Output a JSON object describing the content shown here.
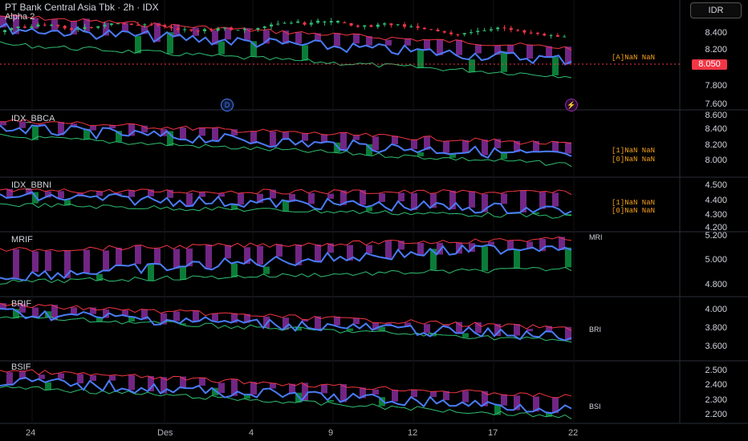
{
  "header": {
    "title": "PT Bank Central Asia Tbk · 2h · IDX",
    "indicator": "Alpha 2"
  },
  "currency_button": "IDR",
  "price_badge": "8.050",
  "main_legend": "[A]NaN NaN",
  "markers": {
    "dividend": "D",
    "split": "⚡"
  },
  "panes": [
    {
      "label": "",
      "ticks": [
        "8.400",
        "8.200",
        "8.000",
        "7.800",
        "7.600"
      ]
    },
    {
      "label": "IDX_BBCA",
      "ticks": [
        "8.600",
        "8.400",
        "8.200",
        "8.000"
      ],
      "legend": [
        "[1]NaN NaN",
        "[0]NaN NaN"
      ]
    },
    {
      "label": "IDX_BBNI",
      "ticks": [
        "4.500",
        "4.400",
        "4.300",
        "4.200"
      ],
      "legend": [
        "[1]NaN NaN",
        "[0]NaN NaN"
      ]
    },
    {
      "label": "MRIF",
      "ticks": [
        "5.200",
        "5.000",
        "4.800"
      ],
      "series": "MRI"
    },
    {
      "label": "BRIF",
      "ticks": [
        "4.000",
        "3.800",
        "3.600"
      ],
      "series": "BRI"
    },
    {
      "label": "BSIF",
      "ticks": [
        "2.500",
        "2.400",
        "2.300",
        "2.200"
      ],
      "series": "BSI"
    }
  ],
  "x_axis": [
    "24",
    "Des",
    "4",
    "9",
    "12",
    "17",
    "22"
  ],
  "colors": {
    "blue": "#4a7cf7",
    "red": "#f23645",
    "green": "#2fbf71",
    "purple": "#7d2a92",
    "fill_green": "#0c8a3e",
    "orange": "#f7a21b"
  }
}
